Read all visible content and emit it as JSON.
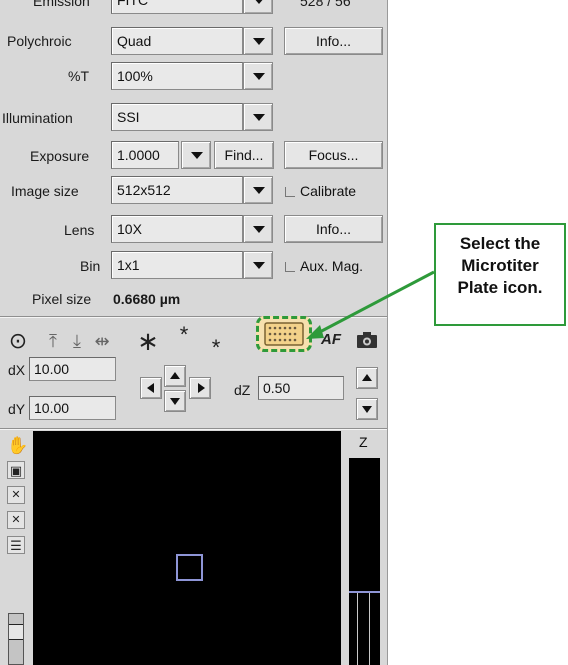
{
  "rows": {
    "emission": {
      "label": "Emission",
      "value": "FITC",
      "right": "528 / 56"
    },
    "polychroic": {
      "label": "Polychroic",
      "value": "Quad",
      "button": "Info..."
    },
    "percent_t": {
      "label": "%T",
      "value": "100%"
    },
    "illumination": {
      "label": "Illumination",
      "value": "SSI"
    },
    "exposure": {
      "label": "Exposure",
      "value": "1.0000",
      "find": "Find...",
      "focus": "Focus..."
    },
    "image_size": {
      "label": "Image size",
      "value": "512x512",
      "checkbox": "Calibrate"
    },
    "lens": {
      "label": "Lens",
      "value": "10X",
      "button": "Info..."
    },
    "bin": {
      "label": "Bin",
      "value": "1x1",
      "checkbox": "Aux. Mag."
    },
    "pixel_size": {
      "label": "Pixel size",
      "value": "0.6680 µm"
    }
  },
  "toolbar": {
    "af_label": "AF",
    "icons": [
      "target-icon",
      "stage-top-icon",
      "stage-bottom-icon",
      "stage-center-icon",
      "asterisk-icon",
      "asterisk-high-icon",
      "asterisk-low-icon",
      "microtiter-plate-icon",
      "autofocus-icon",
      "camera-icon"
    ]
  },
  "stage": {
    "dx_label": "dX",
    "dx_value": "10.00",
    "dy_label": "dY",
    "dy_value": "10.00",
    "dz_label": "dZ",
    "dz_value": "0.50"
  },
  "z_panel": {
    "label": "Z"
  },
  "callout": {
    "line1": "Select the",
    "line2": "Microtiter",
    "line3": "Plate icon."
  },
  "colors": {
    "highlight_green": "#2e9a3a",
    "plate_icon_fill": "#f3d28a",
    "viewport_bg": "#000000",
    "viewport_box": "#8e95d6"
  }
}
